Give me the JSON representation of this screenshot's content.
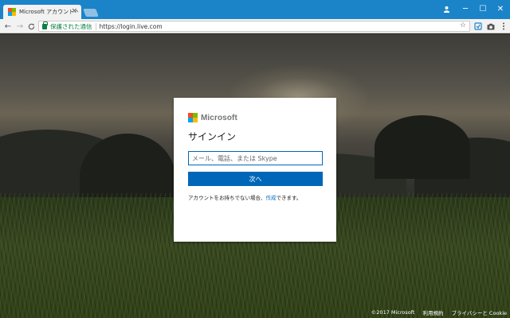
{
  "browser": {
    "tab": {
      "title": "Microsoft アカウントへのサ",
      "close": "×"
    },
    "window_controls": {
      "user": "user-icon",
      "minimize": "─",
      "maximize": "☐",
      "close": "✕"
    },
    "nav": {
      "back": "←",
      "forward": "→",
      "reload": "C"
    },
    "address": {
      "secure_label": "保護された通信",
      "url": "https://login.live.com"
    },
    "star": "☆"
  },
  "brand": {
    "name": "Microsoft",
    "colors": [
      "#f25022",
      "#7fba00",
      "#00a4ef",
      "#ffb900"
    ]
  },
  "signin": {
    "title": "サインイン",
    "input_placeholder": "メール、電話、または Skype",
    "next_label": "次へ",
    "no_account_prefix": "アカウントをお持ちでない場合、",
    "create_link": "作成",
    "no_account_suffix": "できます。"
  },
  "footer": {
    "copyright": "©2017 Microsoft",
    "terms": "利用規約",
    "privacy": "プライバシーと Cookie"
  },
  "colors": {
    "chrome_blue": "#1b84c9",
    "accent": "#0067b8",
    "secure_green": "#0b8043"
  }
}
